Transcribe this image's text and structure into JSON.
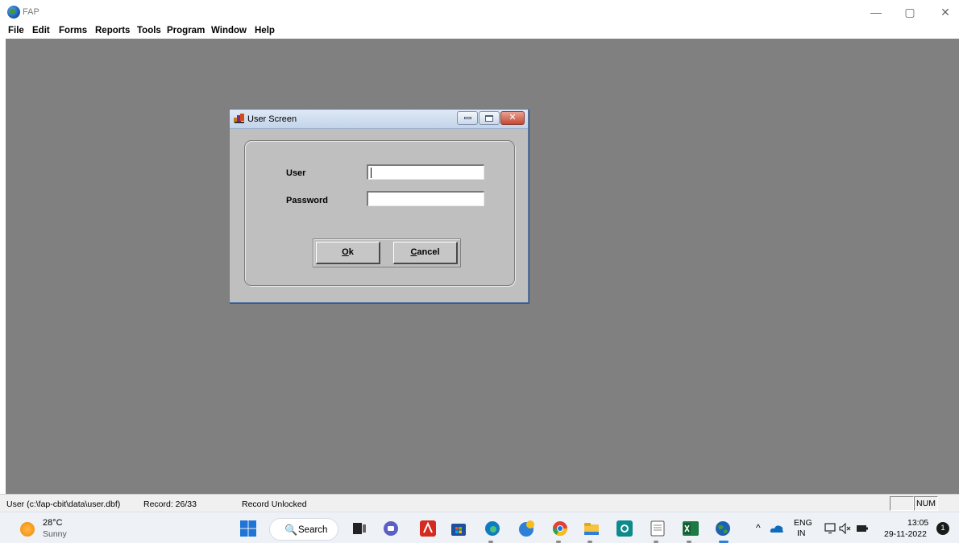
{
  "app": {
    "title": "FAP",
    "window_controls": {
      "minimize": "—",
      "restore": "▢",
      "close": "✕"
    }
  },
  "menu": [
    "File",
    "Edit",
    "Forms",
    "Reports",
    "Tools",
    "Program",
    "Window",
    "Help"
  ],
  "dialog": {
    "title": "User Screen",
    "fields": [
      {
        "label": "User",
        "value": ""
      },
      {
        "label": "Password",
        "value": ""
      }
    ],
    "buttons": {
      "ok": {
        "accel": "O",
        "rest": "k"
      },
      "cancel": {
        "accel": "C",
        "rest": "ancel"
      }
    },
    "controls": {
      "close": "✕"
    }
  },
  "status": {
    "file": "User (c:\\fap-cbit\\data\\user.dbf)",
    "record": "Record: 26/33",
    "lock": "Record Unlocked",
    "num": "NUM"
  },
  "taskbar": {
    "weather_temp": "28°C",
    "weather_desc": "Sunny",
    "search_glyph": "🔍",
    "search_label": "Search",
    "tray_chevron": "^",
    "lang_top": "ENG",
    "lang_bottom": "IN",
    "time": "13:05",
    "date": "29-11-2022",
    "notification_count": "1",
    "icons": [
      "windows-start-icon",
      "task-view-icon",
      "teams-chat-icon",
      "acrobat-icon",
      "store-icon",
      "edge-icon",
      "edge-beta-icon",
      "chrome-icon",
      "file-explorer-icon",
      "camera-app-icon",
      "notepad-icon",
      "excel-icon",
      "fap-app-icon"
    ],
    "colors": {
      "start": "#1f74d6",
      "edge": "#0f7cc2",
      "acrobat": "#d42a1f",
      "excel": "#1d7a44",
      "chrome_red": "#e04336",
      "chrome_yellow": "#f5bf18",
      "chrome_green": "#2aa653",
      "folder": "#f6c240"
    }
  }
}
